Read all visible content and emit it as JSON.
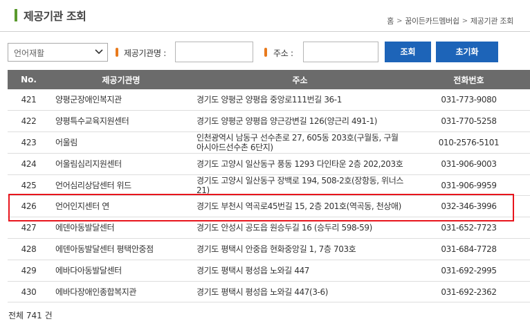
{
  "header": {
    "title": "제공기관 조회",
    "breadcrumb": [
      "홈",
      "꿈이든카드멤버쉽",
      "제공기관 조회"
    ]
  },
  "search": {
    "category_selected": "언어재활",
    "name_label": "제공기관명 :",
    "name_value": "",
    "address_label": "주소 :",
    "address_value": "",
    "search_button": "조회",
    "reset_button": "초기화"
  },
  "table": {
    "headers": {
      "no": "No.",
      "name": "제공기관명",
      "address": "주소",
      "phone": "전화번호"
    },
    "rows": [
      {
        "no": "421",
        "name": "양평군장애인복지관",
        "address": "경기도 양평군 양평읍 중앙로111번길 36-1",
        "phone": "031-773-9080"
      },
      {
        "no": "422",
        "name": "양평특수교육지원센터",
        "address": "경기도 양평군 양평읍 양근강변길 126(양근리 491-1)",
        "phone": "031-770-5258"
      },
      {
        "no": "423",
        "name": "어울림",
        "address": "인천광역시 남동구 선수촌로 27, 605동 203호(구월동, 구월아시아드선수촌 6단지)",
        "phone": "010-2576-5101"
      },
      {
        "no": "424",
        "name": "어울림심리지원센터",
        "address": "경기도 고양시 일산동구 풍동 1293 다인타운 2층 202,203호",
        "phone": "031-906-9003"
      },
      {
        "no": "425",
        "name": "언어심리상담센터 위드",
        "address": "경기도 고양시 일산동구 장백로 194, 508-2호(장항동, 위너스21)",
        "phone": "031-906-9959"
      },
      {
        "no": "426",
        "name": "언어인지센터 연",
        "address": "경기도 부천시 역곡로45번길 15, 2층 201호(역곡동, 천상애)",
        "phone": "032-346-3996"
      },
      {
        "no": "427",
        "name": "에덴아동발달센터",
        "address": "경기도 안성시 공도읍 원승두길 16 (승두리 598-59)",
        "phone": "031-652-7723"
      },
      {
        "no": "428",
        "name": "에덴아동발달센터 평택안중점",
        "address": "경기도 평택시 안중읍 현화중앙길 1, 7층 703호",
        "phone": "031-684-7728"
      },
      {
        "no": "429",
        "name": "에바다아동발달센터",
        "address": "경기도 평택시 평성읍 노와길 447",
        "phone": "031-692-2995"
      },
      {
        "no": "430",
        "name": "에바다장애인종합복지관",
        "address": "경기도 평택시 평성읍 노와길 447(3-6)",
        "phone": "031-692-2362"
      }
    ]
  },
  "footer": {
    "total": "전체 741 건"
  },
  "icons": {
    "dropdown": "chevron-down-icon"
  },
  "colors": {
    "accent_green": "#5a9a2e",
    "marker_orange": "#e87a1d",
    "button_blue": "#1d64b8",
    "header_gray": "#6b6b6b",
    "highlight_red": "#e8141c"
  }
}
